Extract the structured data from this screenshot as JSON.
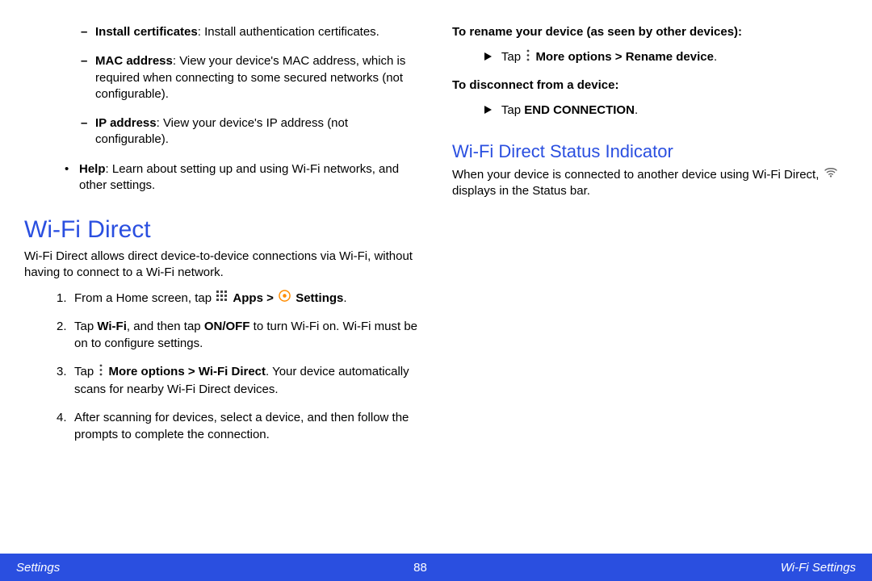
{
  "left": {
    "sub_items": [
      {
        "label": "Install certificates",
        "desc": ": Install authentication certificates."
      },
      {
        "label": "MAC address",
        "desc": ": View your device's MAC address, which is required when connecting to some secured networks (not configurable)."
      },
      {
        "label": "IP address",
        "desc": ": View your device's IP address (not configurable)."
      }
    ],
    "dot_item": {
      "label": "Help",
      "desc": ": Learn about setting up and using Wi-Fi networks, and other settings."
    },
    "h1": "Wi-Fi Direct",
    "intro": "Wi-Fi Direct allows direct device-to-device connections via Wi-Fi, without having to connect to a Wi-Fi network.",
    "steps": {
      "s1_pre": "From a Home screen, tap ",
      "s1_apps": "Apps",
      "s1_gt": " > ",
      "s1_settings": "Settings",
      "s1_post": ".",
      "s2a": "Tap ",
      "s2_wifi": "Wi-Fi",
      "s2b": ", and then tap ",
      "s2_onoff": "ON/OFF",
      "s2c": " to turn Wi-Fi on. Wi-Fi must be on to configure settings.",
      "s3a": "Tap ",
      "s3_more": "More options",
      "s3_gt": " > ",
      "s3_wfd": "Wi-Fi Direct",
      "s3b": ". Your device automatically scans for nearby Wi-Fi Direct devices.",
      "s4": "After scanning for devices, select a device, and then follow the prompts to complete the connection."
    }
  },
  "right": {
    "rename_heading": "To rename your device (as seen by other devices):",
    "rename_tap": "Tap ",
    "rename_more": "More options",
    "rename_gt": " > ",
    "rename_target": "Rename device",
    "rename_post": ".",
    "disc_heading": "To disconnect from a device:",
    "disc_tap": "Tap ",
    "disc_end": "END CONNECTION",
    "disc_post": ".",
    "h2": "Wi-Fi Direct Status Indicator",
    "status_a": "When your device is connected to another device using Wi-Fi Direct, ",
    "status_b": " displays in the Status bar."
  },
  "footer": {
    "left": "Settings",
    "page": "88",
    "right": "Wi-Fi Settings"
  },
  "icons": {
    "apps": "apps-grid-icon",
    "settings": "settings-gear-icon",
    "more": "more-options-icon",
    "wifi": "wifi-signal-icon"
  }
}
